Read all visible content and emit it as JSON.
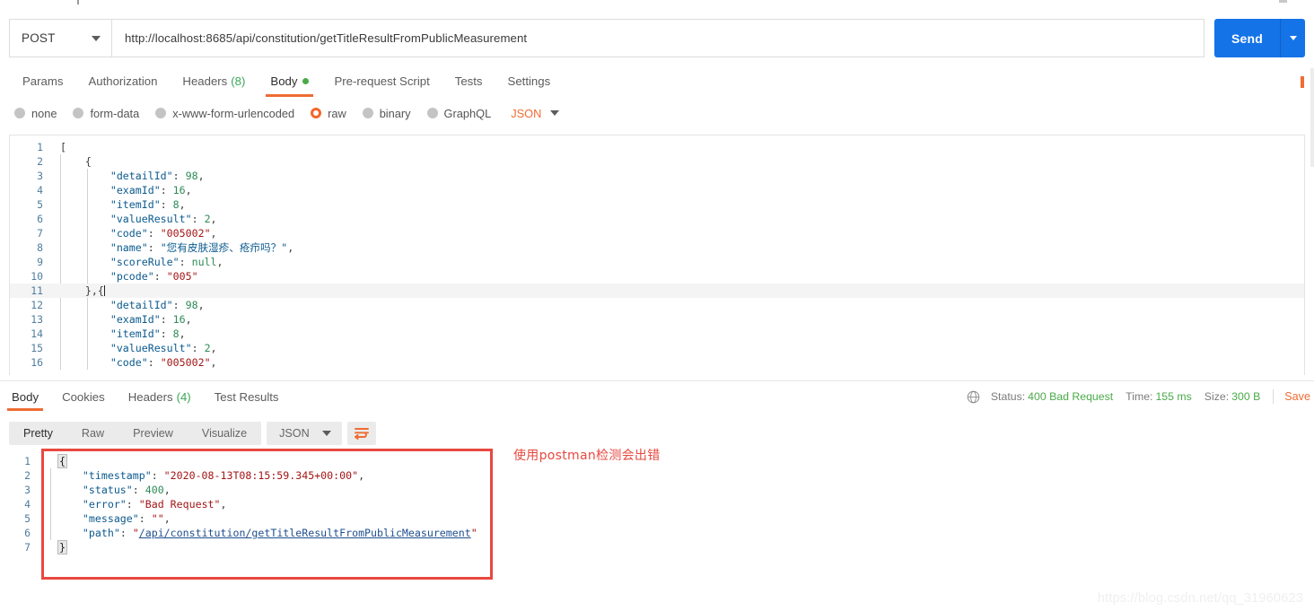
{
  "request": {
    "method": "POST",
    "method_caret_icon": "chevron-down-icon",
    "url": "http://localhost:8685/api/constitution/getTitleResultFromPublicMeasurement",
    "send_label": "Send",
    "send_caret_icon": "chevron-down-icon",
    "tabs": [
      {
        "label": "Params",
        "active": false
      },
      {
        "label": "Authorization",
        "active": false
      },
      {
        "label": "Headers",
        "count": "(8)",
        "active": false
      },
      {
        "label": "Body",
        "active": true,
        "dot": true
      },
      {
        "label": "Pre-request Script",
        "active": false
      },
      {
        "label": "Tests",
        "active": false
      },
      {
        "label": "Settings",
        "active": false
      }
    ],
    "body_types": [
      {
        "label": "none",
        "selected": false
      },
      {
        "label": "form-data",
        "selected": false
      },
      {
        "label": "x-www-form-urlencoded",
        "selected": false
      },
      {
        "label": "raw",
        "selected": true
      },
      {
        "label": "binary",
        "selected": false
      },
      {
        "label": "GraphQL",
        "selected": false
      }
    ],
    "format_label": "JSON",
    "format_caret_icon": "chevron-down-icon",
    "editor_lines": [
      {
        "no": "1",
        "indent": 0,
        "tokens": [
          {
            "t": "[",
            "c": "p"
          }
        ]
      },
      {
        "no": "2",
        "indent": 1,
        "tokens": [
          {
            "t": "{",
            "c": "p"
          }
        ]
      },
      {
        "no": "3",
        "indent": 2,
        "tokens": [
          {
            "t": "\"detailId\"",
            "c": "k"
          },
          {
            "t": ": ",
            "c": "p"
          },
          {
            "t": "98",
            "c": "n"
          },
          {
            "t": ",",
            "c": "p"
          }
        ]
      },
      {
        "no": "4",
        "indent": 2,
        "tokens": [
          {
            "t": "\"examId\"",
            "c": "k"
          },
          {
            "t": ": ",
            "c": "p"
          },
          {
            "t": "16",
            "c": "n"
          },
          {
            "t": ",",
            "c": "p"
          }
        ]
      },
      {
        "no": "5",
        "indent": 2,
        "tokens": [
          {
            "t": "\"itemId\"",
            "c": "k"
          },
          {
            "t": ": ",
            "c": "p"
          },
          {
            "t": "8",
            "c": "n"
          },
          {
            "t": ",",
            "c": "p"
          }
        ]
      },
      {
        "no": "6",
        "indent": 2,
        "tokens": [
          {
            "t": "\"valueResult\"",
            "c": "k"
          },
          {
            "t": ": ",
            "c": "p"
          },
          {
            "t": "2",
            "c": "n"
          },
          {
            "t": ",",
            "c": "p"
          }
        ]
      },
      {
        "no": "7",
        "indent": 2,
        "tokens": [
          {
            "t": "\"code\"",
            "c": "k"
          },
          {
            "t": ": ",
            "c": "p"
          },
          {
            "t": "\"005002\"",
            "c": "s"
          },
          {
            "t": ",",
            "c": "p"
          }
        ]
      },
      {
        "no": "8",
        "indent": 2,
        "tokens": [
          {
            "t": "\"name\"",
            "c": "k"
          },
          {
            "t": ": ",
            "c": "p"
          },
          {
            "t": "\"您有皮肤湿疹、疮疖吗？\"",
            "c": "cn"
          },
          {
            "t": ",",
            "c": "p"
          }
        ]
      },
      {
        "no": "9",
        "indent": 2,
        "tokens": [
          {
            "t": "\"scoreRule\"",
            "c": "k"
          },
          {
            "t": ": ",
            "c": "p"
          },
          {
            "t": "null",
            "c": "nul"
          },
          {
            "t": ",",
            "c": "p"
          }
        ]
      },
      {
        "no": "10",
        "indent": 2,
        "tokens": [
          {
            "t": "\"pcode\"",
            "c": "k"
          },
          {
            "t": ": ",
            "c": "p"
          },
          {
            "t": "\"005\"",
            "c": "s"
          }
        ]
      },
      {
        "no": "11",
        "indent": 1,
        "highlight": true,
        "caret": true,
        "tokens": [
          {
            "t": "},{",
            "c": "p"
          }
        ]
      },
      {
        "no": "12",
        "indent": 2,
        "tokens": [
          {
            "t": "\"detailId\"",
            "c": "k"
          },
          {
            "t": ": ",
            "c": "p"
          },
          {
            "t": "98",
            "c": "n"
          },
          {
            "t": ",",
            "c": "p"
          }
        ]
      },
      {
        "no": "13",
        "indent": 2,
        "tokens": [
          {
            "t": "\"examId\"",
            "c": "k"
          },
          {
            "t": ": ",
            "c": "p"
          },
          {
            "t": "16",
            "c": "n"
          },
          {
            "t": ",",
            "c": "p"
          }
        ]
      },
      {
        "no": "14",
        "indent": 2,
        "tokens": [
          {
            "t": "\"itemId\"",
            "c": "k"
          },
          {
            "t": ": ",
            "c": "p"
          },
          {
            "t": "8",
            "c": "n"
          },
          {
            "t": ",",
            "c": "p"
          }
        ]
      },
      {
        "no": "15",
        "indent": 2,
        "tokens": [
          {
            "t": "\"valueResult\"",
            "c": "k"
          },
          {
            "t": ": ",
            "c": "p"
          },
          {
            "t": "2",
            "c": "n"
          },
          {
            "t": ",",
            "c": "p"
          }
        ]
      },
      {
        "no": "16",
        "indent": 2,
        "tokens": [
          {
            "t": "\"code\"",
            "c": "k"
          },
          {
            "t": ": ",
            "c": "p"
          },
          {
            "t": "\"005002\"",
            "c": "s"
          },
          {
            "t": ",",
            "c": "p"
          }
        ]
      }
    ]
  },
  "response": {
    "tabs": [
      {
        "label": "Body",
        "active": true
      },
      {
        "label": "Cookies",
        "active": false
      },
      {
        "label": "Headers",
        "count": "(4)",
        "active": false
      },
      {
        "label": "Test Results",
        "active": false
      }
    ],
    "globe_icon": "globe-icon",
    "status_label": "Status:",
    "status_value": "400 Bad Request",
    "time_label": "Time:",
    "time_value": "155 ms",
    "size_label": "Size:",
    "size_value": "300 B",
    "save_label": "Save",
    "views": [
      {
        "label": "Pretty",
        "active": true
      },
      {
        "label": "Raw",
        "active": false
      },
      {
        "label": "Preview",
        "active": false
      },
      {
        "label": "Visualize",
        "active": false
      }
    ],
    "format_label": "JSON",
    "format_caret_icon": "chevron-down-icon",
    "wrap_icon": "wrap-text-icon",
    "body_lines": [
      {
        "no": "1",
        "indent": 0,
        "brace": "{",
        "tokens": []
      },
      {
        "no": "2",
        "indent": 1,
        "tokens": [
          {
            "t": "\"timestamp\"",
            "c": "k"
          },
          {
            "t": ": ",
            "c": "p"
          },
          {
            "t": "\"2020-08-13T08:15:59.345+00:00\"",
            "c": "s"
          },
          {
            "t": ",",
            "c": "p"
          }
        ]
      },
      {
        "no": "3",
        "indent": 1,
        "tokens": [
          {
            "t": "\"status\"",
            "c": "k"
          },
          {
            "t": ": ",
            "c": "p"
          },
          {
            "t": "400",
            "c": "n"
          },
          {
            "t": ",",
            "c": "p"
          }
        ]
      },
      {
        "no": "4",
        "indent": 1,
        "tokens": [
          {
            "t": "\"error\"",
            "c": "k"
          },
          {
            "t": ": ",
            "c": "p"
          },
          {
            "t": "\"Bad Request\"",
            "c": "s"
          },
          {
            "t": ",",
            "c": "p"
          }
        ]
      },
      {
        "no": "5",
        "indent": 1,
        "tokens": [
          {
            "t": "\"message\"",
            "c": "k"
          },
          {
            "t": ": ",
            "c": "p"
          },
          {
            "t": "\"\"",
            "c": "s"
          },
          {
            "t": ",",
            "c": "p"
          }
        ]
      },
      {
        "no": "6",
        "indent": 1,
        "tokens": [
          {
            "t": "\"path\"",
            "c": "k"
          },
          {
            "t": ": ",
            "c": "p"
          },
          {
            "t": "\"",
            "c": "s"
          },
          {
            "t": "/api/constitution/getTitleResultFromPublicMeasurement",
            "c": "lnk"
          },
          {
            "t": "\"",
            "c": "s"
          }
        ]
      },
      {
        "no": "7",
        "indent": 0,
        "brace": "}",
        "tokens": []
      }
    ]
  },
  "annotation": {
    "text": "使用postman检测会出错",
    "color": "#e8483f"
  },
  "watermark": "https://blog.csdn.net/qq_31960623"
}
